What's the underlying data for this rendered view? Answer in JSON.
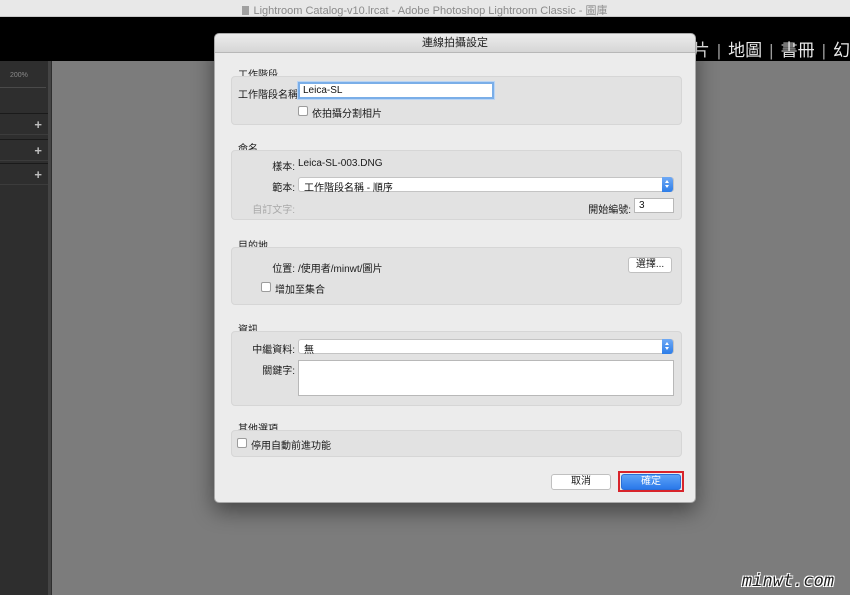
{
  "window": {
    "title": "Lightroom Catalog-v10.lrcat - Adobe Photoshop Lightroom Classic - 圖庫"
  },
  "lightroom": {
    "module_partial_left": "片",
    "modules": [
      "地圖",
      "書冊"
    ],
    "module_partial_right": "幻",
    "left_panel": {
      "zoom": "200%"
    }
  },
  "dialog": {
    "title": "連線拍攝設定",
    "session": {
      "heading": "工作階段",
      "name_label": "工作階段名稱:",
      "name_value": "Leica-SL",
      "segment_label": "依拍攝分割相片"
    },
    "naming": {
      "heading": "命名",
      "sample_label": "樣本:",
      "sample_value": "Leica-SL-003.DNG",
      "template_label": "範本:",
      "template_value": "工作階段名稱 - 順序",
      "custom_text_label": "自訂文字:",
      "start_number_label": "開始編號:",
      "start_number_value": "3"
    },
    "destination": {
      "heading": "目的地",
      "location_label": "位置:",
      "location_value": "/使用者/minwt/圖片",
      "choose_button": "選擇...",
      "add_collection_label": "增加至集合"
    },
    "information": {
      "heading": "資訊",
      "metadata_label": "中繼資料:",
      "metadata_value": "無",
      "keywords_label": "關鍵字:"
    },
    "other": {
      "heading": "其他選項",
      "disable_autoadvance_label": "停用自動前進功能"
    },
    "buttons": {
      "cancel": "取消",
      "ok": "確定"
    }
  },
  "watermark": "minwt.com",
  "colors": {
    "accent": "#2a78ea",
    "highlight": "#d8242b",
    "focus": "#7aaee8"
  }
}
